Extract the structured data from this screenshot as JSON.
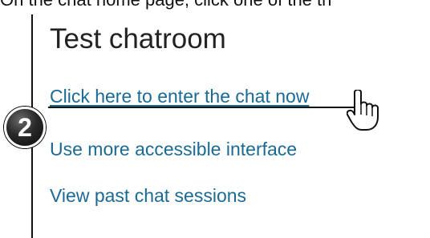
{
  "caption": "On the chat home page, click one of the th",
  "panel": {
    "title": "Test chatroom",
    "links": [
      {
        "label": "Click here to enter the chat now"
      },
      {
        "label": "Use more accessible interface"
      },
      {
        "label": "View past chat sessions"
      }
    ]
  },
  "annotation": {
    "step_number": "2",
    "cursor_icon": "hand-pointer-icon"
  },
  "colors": {
    "link": "#1a6a93",
    "title": "#222222",
    "badge": "#1e1e1e"
  }
}
